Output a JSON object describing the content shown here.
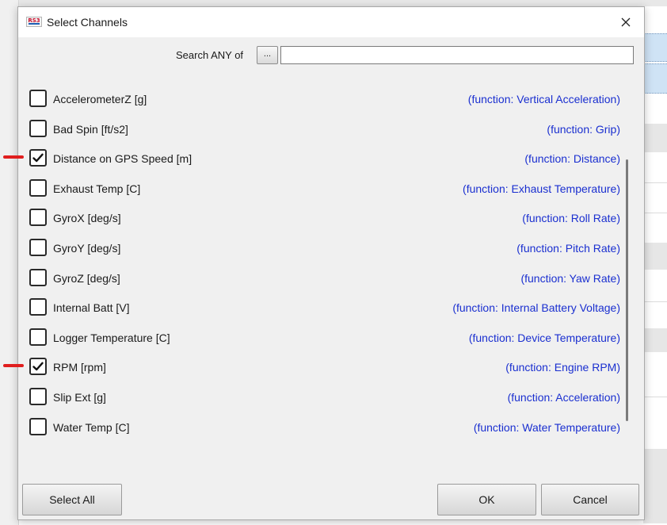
{
  "dialog": {
    "title": "Select Channels",
    "logo_text": "RS3"
  },
  "search": {
    "label": "Search ANY of",
    "dots_label": "...",
    "value": "",
    "placeholder": ""
  },
  "channels": [
    {
      "name": "AccelerometerZ [g]",
      "function": "(function: Vertical Acceleration)",
      "checked": false
    },
    {
      "name": "Bad Spin [ft/s2]",
      "function": "(function: Grip)",
      "checked": false
    },
    {
      "name": "Distance on GPS Speed [m]",
      "function": "(function: Distance)",
      "checked": true
    },
    {
      "name": "Exhaust Temp [C]",
      "function": "(function: Exhaust Temperature)",
      "checked": false
    },
    {
      "name": "GyroX [deg/s]",
      "function": "(function: Roll Rate)",
      "checked": false
    },
    {
      "name": "GyroY [deg/s]",
      "function": "(function: Pitch Rate)",
      "checked": false
    },
    {
      "name": "GyroZ [deg/s]",
      "function": "(function: Yaw Rate)",
      "checked": false
    },
    {
      "name": "Internal Batt [V]",
      "function": "(function: Internal Battery Voltage)",
      "checked": false
    },
    {
      "name": "Logger Temperature [C]",
      "function": "(function: Device Temperature)",
      "checked": false
    },
    {
      "name": "RPM [rpm]",
      "function": "(function: Engine RPM)",
      "checked": true
    },
    {
      "name": "Slip Ext [g]",
      "function": "(function: Acceleration)",
      "checked": false
    },
    {
      "name": "Water Temp [C]",
      "function": "(function: Water Temperature)",
      "checked": false
    }
  ],
  "buttons": {
    "select_all": "Select All",
    "ok": "OK",
    "cancel": "Cancel"
  },
  "colors": {
    "function_text": "#1a2fd0",
    "annotation_mark": "#e01e1e",
    "selection_bg": "#cfe3f5"
  },
  "icons": {
    "close": "close-icon",
    "check": "checkmark-icon",
    "logo": "app-logo-icon"
  }
}
